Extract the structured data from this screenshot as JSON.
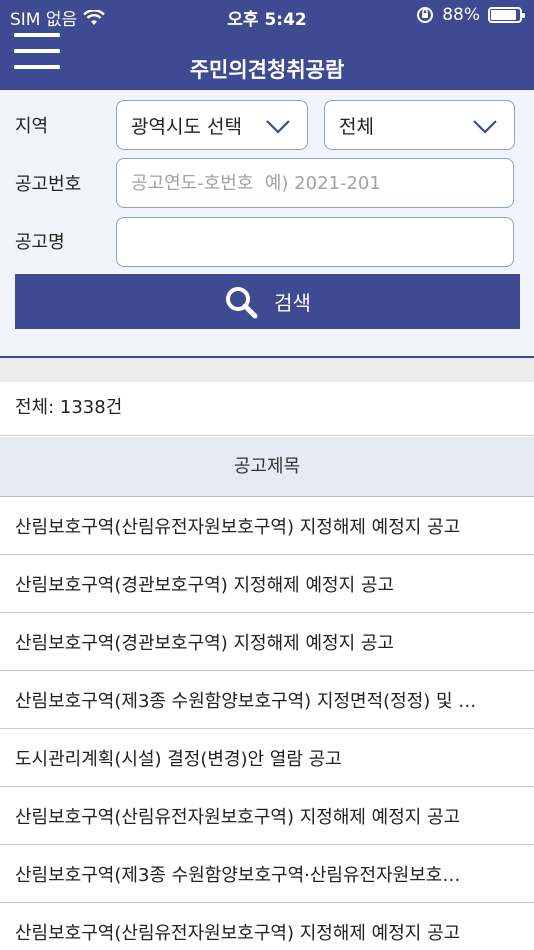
{
  "status_bar": {
    "carrier": "SIM 없음",
    "time": "오후 5:42",
    "battery": "88%",
    "battery_level": 0.88
  },
  "header": {
    "title": "주민의견청취공람",
    "menu_icon": "hamburger-menu-icon"
  },
  "filter": {
    "region_label": "지역",
    "region_select": "광역시도 선택",
    "sub_select": "전체",
    "number_label": "공고번호",
    "number_placeholder": "공고연도-호번호  예) 2021-201",
    "number_value": "",
    "name_label": "공고명",
    "name_value": "",
    "search_label": "검색",
    "search_icon": "search-icon"
  },
  "results": {
    "total": "전체: 1338건",
    "column_header": "공고제목",
    "items": [
      "산림보호구역(산림유전자원보호구역) 지정해제 예정지 공고",
      "산림보호구역(경관보호구역) 지정해제 예정지 공고",
      "산림보호구역(경관보호구역) 지정해제 예정지 공고",
      "산림보호구역(제3종 수원함양보호구역) 지정면적(정정) 및 …",
      "도시관리계획(시설) 결정(변경)안 열람 공고",
      "산림보호구역(산림유전자원보호구역) 지정해제 예정지 공고",
      "산림보호구역(제3종 수원함양보호구역·산림유전자원보호…",
      "산림보호구역(산림유전자원보호구역) 지정해제 예정지 공고"
    ]
  },
  "colors": {
    "primary": "#3e4a91",
    "panel_bg": "#f1f4fa",
    "header_row_bg": "#e6eaf3"
  }
}
